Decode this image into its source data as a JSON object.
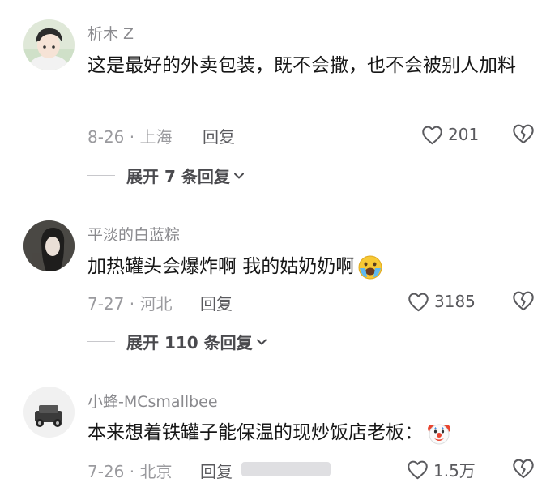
{
  "comments": [
    {
      "username": "析木 Z",
      "text": "这是最好的外卖包装，既不会撒，也不会被别人加料",
      "date_location": "8-26 · 上海",
      "reply_label": "回复",
      "likes": "201",
      "expand_label": "展开 7 条回复"
    },
    {
      "username": "平淡的白蓝粽",
      "text": "加热罐头会爆炸啊 我的姑奶奶啊",
      "emoji": "crying-emoji",
      "date_location": "7-27 · 河北",
      "reply_label": "回复",
      "likes": "3185",
      "expand_label": "展开 110 条回复"
    },
    {
      "username": "小蜂-MCsmallbee",
      "text": "本来想着铁罐子能保温的现炒饭店老板：",
      "emoji": "clown-emoji",
      "date_location": "7-26 · 北京",
      "reply_label": "回复",
      "likes": "1.5万"
    }
  ],
  "icons": {
    "like": "heart-icon",
    "dislike": "broken-heart-icon",
    "expand": "chevron-down-icon"
  },
  "colors": {
    "text": "#161616",
    "secondary": "#8a8a8e",
    "action": "#5a5a5e"
  }
}
